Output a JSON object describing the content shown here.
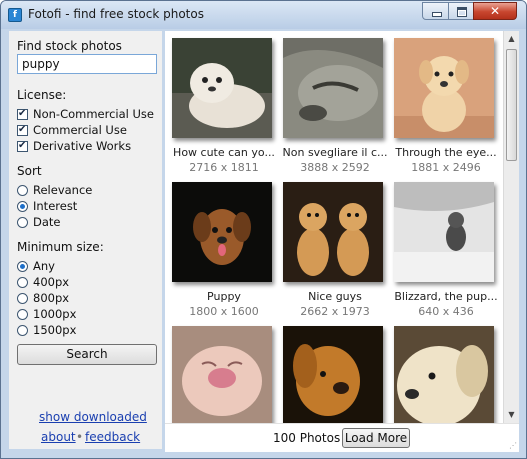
{
  "window": {
    "title": "Fotofi - find free stock photos",
    "icon": "app-icon",
    "icon_glyph": "f"
  },
  "sidebar": {
    "search_label": "Find stock photos about:",
    "search_value": "puppy",
    "license": {
      "label": "License:",
      "options": [
        {
          "label": "Non-Commercial Use",
          "checked": true
        },
        {
          "label": "Commercial Use",
          "checked": true
        },
        {
          "label": "Derivative Works",
          "checked": true
        }
      ]
    },
    "sort": {
      "label": "Sort",
      "options": [
        {
          "label": "Relevance",
          "selected": false
        },
        {
          "label": "Interest",
          "selected": true
        },
        {
          "label": "Date",
          "selected": false
        }
      ]
    },
    "min_size": {
      "label": "Minimum size:",
      "options": [
        {
          "label": "Any",
          "selected": true
        },
        {
          "label": "400px",
          "selected": false
        },
        {
          "label": "800px",
          "selected": false
        },
        {
          "label": "1000px",
          "selected": false
        },
        {
          "label": "1500px",
          "selected": false
        }
      ]
    },
    "search_button": "Search",
    "show_downloaded": "show downloaded",
    "about": "about",
    "separator": "•",
    "feedback": "feedback"
  },
  "photos": [
    {
      "caption": "How cute can yo...",
      "dims": "2716 x 1811"
    },
    {
      "caption": "Non svegliare il c...",
      "dims": "3888 x 2592"
    },
    {
      "caption": "Through the eye...",
      "dims": "1881 x 2496"
    },
    {
      "caption": "Puppy",
      "dims": "1800 x 1600"
    },
    {
      "caption": "Nice guys",
      "dims": "2662 x 1973"
    },
    {
      "caption": "Blizzard, the pup...",
      "dims": "640 x 436"
    },
    {
      "caption": "",
      "dims": ""
    },
    {
      "caption": "",
      "dims": ""
    },
    {
      "caption": "",
      "dims": ""
    }
  ],
  "footer": {
    "count": "100 Photos",
    "load_more": "Load More"
  },
  "colors": {
    "link": "#1a3fb0",
    "accent": "#1f6fc8",
    "frame": "#c5d6ea"
  }
}
